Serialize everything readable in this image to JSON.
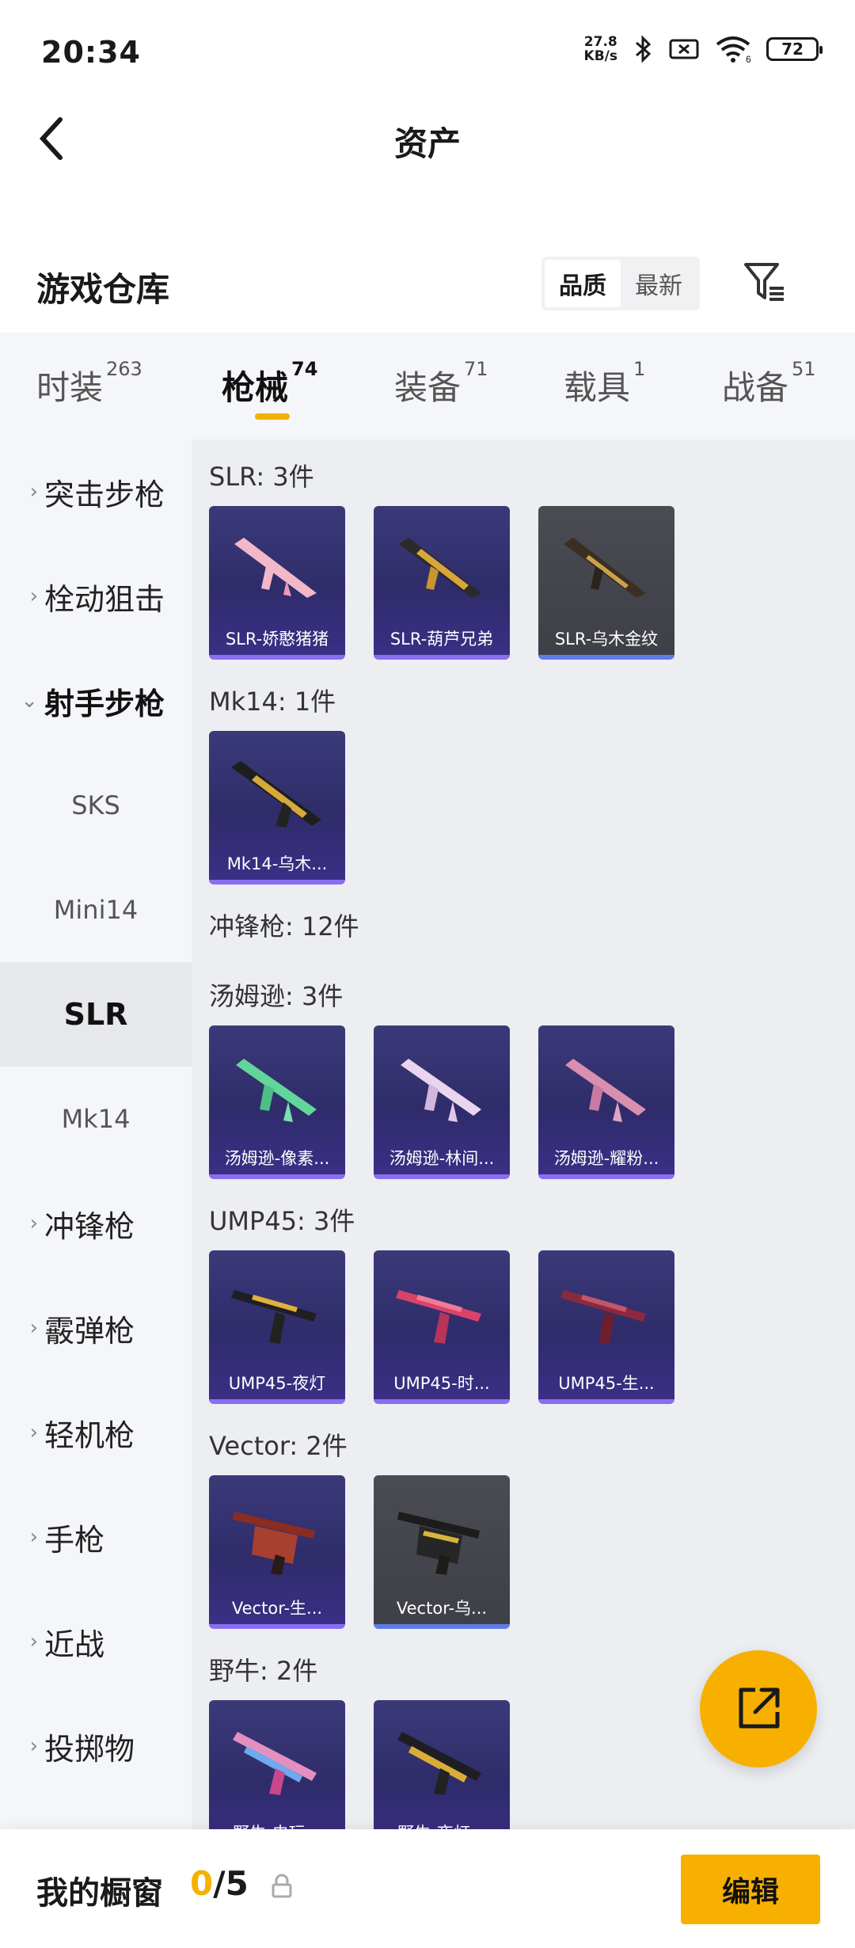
{
  "status_bar": {
    "time": "20:34",
    "net_speed_value": "27.8",
    "net_speed_unit": "KB/s",
    "wifi_label": "6",
    "battery": "72",
    "icons": [
      "bluetooth-icon",
      "sim-off-icon",
      "wifi-icon",
      "battery-icon"
    ]
  },
  "nav": {
    "title": "资产",
    "back_icon": "chevron-left-icon"
  },
  "header": {
    "title": "游戏仓库",
    "sort_options": [
      "品质",
      "最新"
    ],
    "sort_selected": "品质",
    "filter_icon": "filter-icon"
  },
  "tabs": [
    {
      "label": "时装",
      "count": "263"
    },
    {
      "label": "枪械",
      "count": "74",
      "active": true
    },
    {
      "label": "装备",
      "count": "71"
    },
    {
      "label": "载具",
      "count": "1"
    },
    {
      "label": "战备",
      "count": "51"
    }
  ],
  "side_menu": {
    "items": [
      {
        "label": "突击步枪"
      },
      {
        "label": "栓动狙击"
      },
      {
        "label": "射手步枪",
        "open": true
      },
      {
        "label": "SKS"
      },
      {
        "label": "Mini14"
      },
      {
        "label": "SLR",
        "selected": true
      },
      {
        "label": "Mk14"
      },
      {
        "label": "冲锋枪"
      },
      {
        "label": "霰弹枪"
      },
      {
        "label": "轻机枪"
      },
      {
        "label": "手枪"
      },
      {
        "label": "近战"
      },
      {
        "label": "投掷物"
      }
    ]
  },
  "content": {
    "groups": [
      {
        "label": "SLR: 3件",
        "items": [
          "SLR-娇憨猪猪",
          "SLR-葫芦兄弟",
          "SLR-乌木金纹"
        ]
      },
      {
        "label": "Mk14: 1件",
        "items": [
          "Mk14-乌木..."
        ]
      },
      {
        "label": "冲锋枪: 12件",
        "items": []
      },
      {
        "label": "汤姆逊: 3件",
        "items": [
          "汤姆逊-像素...",
          "汤姆逊-林间...",
          "汤姆逊-耀粉..."
        ]
      },
      {
        "label": "UMP45: 3件",
        "items": [
          "UMP45-夜灯",
          "UMP45-时...",
          "UMP45-生..."
        ]
      },
      {
        "label": "Vector: 2件",
        "items": [
          "Vector-生...",
          "Vector-乌..."
        ]
      },
      {
        "label": "野牛: 2件",
        "items": [
          "野牛-电玩...",
          "野牛-夜灯..."
        ]
      }
    ]
  },
  "fab": {
    "icon": "share-external-icon"
  },
  "bottom_bar": {
    "label": "我的橱窗",
    "current": "0",
    "separator": "/",
    "max": "5",
    "edit_label": "编辑"
  },
  "colors": {
    "accent": "#f7b000",
    "card_purple": "#352f74",
    "card_grey": "#45464d"
  }
}
